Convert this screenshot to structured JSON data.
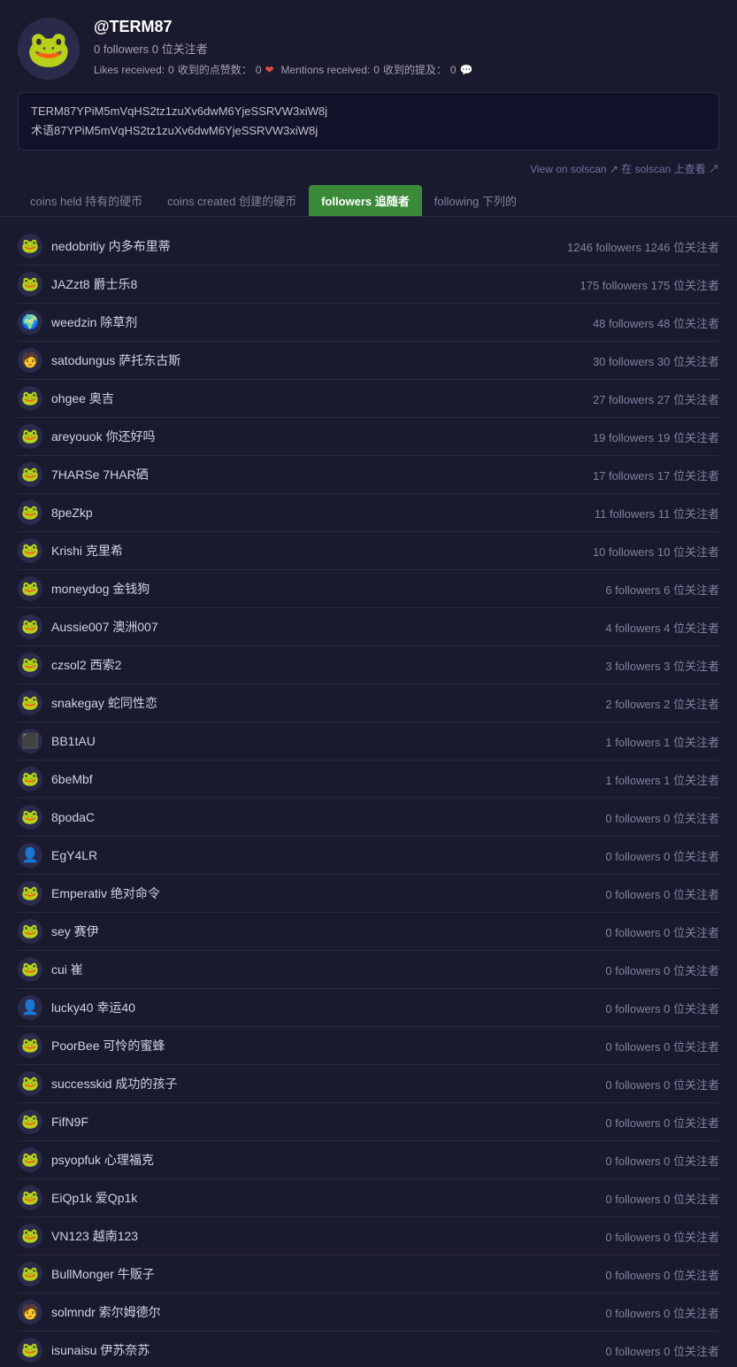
{
  "profile": {
    "username": "@TERM87",
    "follow_stats": "0 followers 0 位关注者",
    "likes_label": "Likes received:",
    "likes_value": "0",
    "likes_label_cn": "收到的点赞数：",
    "likes_value_cn": "0",
    "mentions_label": "Mentions received:",
    "mentions_value": "0",
    "mentions_label_cn": "收到的提及：",
    "mentions_value_cn": "0",
    "address1": "TERM87YPiM5mVqHS2tz1zuXv6dwM6YjeSSRVW3xiW8j",
    "address2": "术语87YPiM5mVqHS2tz1zuXv6dwM6YjeSSRVW3xiW8j",
    "solscan_text": "View on solscan ↗ 在 solscan 上查看 ↗",
    "avatar_emoji": "🐸"
  },
  "tabs": [
    {
      "label": "coins held 持有的硬币",
      "active": false
    },
    {
      "label": "coins created 创建的硬币",
      "active": false
    },
    {
      "label": "followers 追随者",
      "active": true
    },
    {
      "label": "following 下列的",
      "active": false
    }
  ],
  "followers": [
    {
      "name": "nedobritiy  内多布里蒂",
      "stats": "1246 followers 1246 位关注者",
      "emoji": "🐸"
    },
    {
      "name": "JAZzt8  爵士乐8",
      "stats": "175 followers 175 位关注者",
      "emoji": "🐸"
    },
    {
      "name": "weedzin  除草剂",
      "stats": "48 followers 48 位关注者",
      "emoji": "🌍"
    },
    {
      "name": "satodungus  萨托东古斯",
      "stats": "30 followers 30 位关注者",
      "emoji": "🧑"
    },
    {
      "name": "ohgee  奥吉",
      "stats": "27 followers 27 位关注者",
      "emoji": "🐸"
    },
    {
      "name": "areyouok  你还好吗",
      "stats": "19 followers 19 位关注者",
      "emoji": "🐸"
    },
    {
      "name": "7HARSe  7HAR硒",
      "stats": "17 followers 17 位关注者",
      "emoji": "🐸"
    },
    {
      "name": "8peZkp",
      "stats": "11 followers 11 位关注者",
      "emoji": "🐸"
    },
    {
      "name": "Krishi  克里希",
      "stats": "10 followers 10 位关注者",
      "emoji": "🐸"
    },
    {
      "name": "moneydog  金钱狗",
      "stats": "6 followers 6 位关注者",
      "emoji": "🐸"
    },
    {
      "name": "Aussie007  澳洲007",
      "stats": "4 followers 4 位关注者",
      "emoji": "🐸"
    },
    {
      "name": "czsol2  西索2",
      "stats": "3 followers 3 位关注者",
      "emoji": "🐸"
    },
    {
      "name": "snakegay  蛇同性恋",
      "stats": "2 followers 2 位关注者",
      "emoji": "🐸"
    },
    {
      "name": "BB1tAU",
      "stats": "1 followers 1 位关注者",
      "emoji": "⬛"
    },
    {
      "name": "6beMbf",
      "stats": "1 followers 1 位关注者",
      "emoji": "🐸"
    },
    {
      "name": "8podaC",
      "stats": "0 followers 0 位关注者",
      "emoji": "🐸"
    },
    {
      "name": "EgY4LR",
      "stats": "0 followers 0 位关注者",
      "emoji": "👤"
    },
    {
      "name": "Emperativ  绝对命令",
      "stats": "0 followers 0 位关注者",
      "emoji": "🐸"
    },
    {
      "name": "sey  赛伊",
      "stats": "0 followers 0 位关注者",
      "emoji": "🐸"
    },
    {
      "name": "cui  崔",
      "stats": "0 followers 0 位关注者",
      "emoji": "🐸"
    },
    {
      "name": "lucky40  幸运40",
      "stats": "0 followers 0 位关注者",
      "emoji": "👤"
    },
    {
      "name": "PoorBee  可怜的蜜蜂",
      "stats": "0 followers 0 位关注者",
      "emoji": "🐸"
    },
    {
      "name": "successkid  成功的孩子",
      "stats": "0 followers 0 位关注者",
      "emoji": "🐸"
    },
    {
      "name": "FifN9F",
      "stats": "0 followers 0 位关注者",
      "emoji": "🐸"
    },
    {
      "name": "psyopfuk  心理福克",
      "stats": "0 followers 0 位关注者",
      "emoji": "🐸"
    },
    {
      "name": "EiQp1k  爱Qp1k",
      "stats": "0 followers 0 位关注者",
      "emoji": "🐸"
    },
    {
      "name": "VN123  越南123",
      "stats": "0 followers 0 位关注者",
      "emoji": "🐸"
    },
    {
      "name": "BullMonger  牛贩子",
      "stats": "0 followers 0 位关注者",
      "emoji": "🐸"
    },
    {
      "name": "solmndr  索尔姆德尔",
      "stats": "0 followers 0 位关注者",
      "emoji": "🧑"
    },
    {
      "name": "isunaisu  伊苏奈苏",
      "stats": "0 followers 0 位关注者",
      "emoji": "🐸"
    }
  ]
}
